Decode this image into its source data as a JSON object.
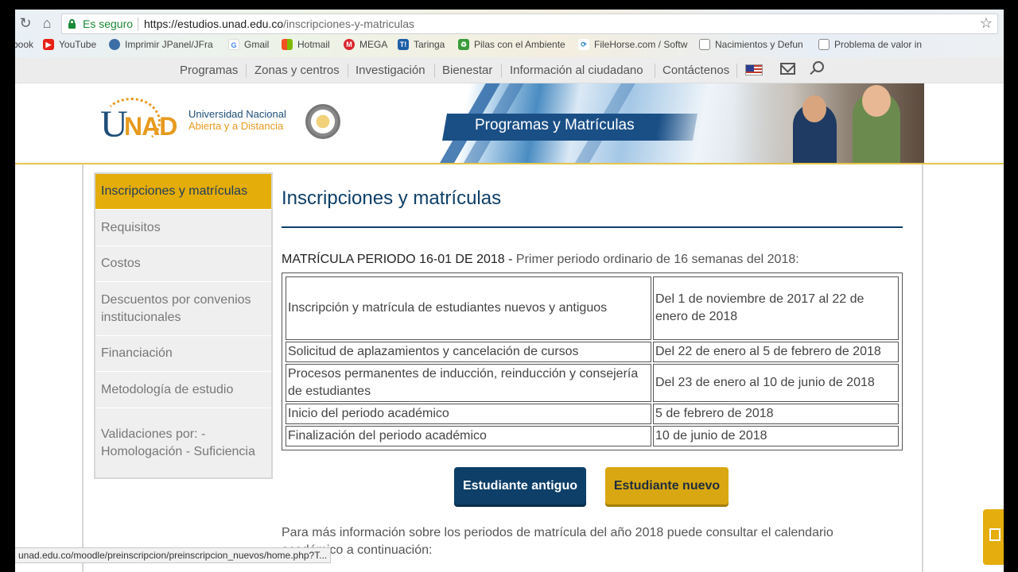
{
  "browser": {
    "secure_label": "Es seguro",
    "url_host": "https://estudios.unad.edu.co",
    "url_path": "/inscripciones-y-matriculas",
    "bookmarks": [
      {
        "label": "book"
      },
      {
        "label": "YouTube"
      },
      {
        "label": "Imprimir JPanel/JFra"
      },
      {
        "label": "Gmail"
      },
      {
        "label": "Hotmail"
      },
      {
        "label": "MEGA"
      },
      {
        "label": "Taringa"
      },
      {
        "label": "Pilas con el Ambiente"
      },
      {
        "label": "FileHorse.com / Softw"
      },
      {
        "label": "Nacimientos y Defun"
      },
      {
        "label": "Problema de valor in"
      }
    ]
  },
  "sitenav": {
    "items": [
      "Programas",
      "Zonas y centros",
      "Investigación",
      "Bienestar",
      "Información al ciudadano",
      "Contáctenos"
    ]
  },
  "header": {
    "logo_u": "U",
    "logo_nad": "NAD",
    "uni_line1": "Universidad Nacional",
    "uni_line2": "Abierta y a Distancia",
    "banner_title": "Programas y Matrículas"
  },
  "sidebar": {
    "items": [
      "Inscripciones y matrículas",
      "Requisitos",
      "Costos",
      "Descuentos por convenios institucionales",
      "Financiación",
      "Metodología de estudio",
      "Validaciones por: - Homologación - Suficiencia"
    ]
  },
  "main": {
    "title": "Inscripciones y matrículas",
    "period_bold": "MATRÍCULA PERIODO 16-01 DE 2018 -",
    "period_rest": " Primer periodo ordinario de 16 semanas del 2018:",
    "schedule": [
      {
        "activity": "Inscripción y matrícula de estudiantes nuevos y antiguos",
        "dates": "Del 1 de noviembre de 2017 al 22 de enero de 2018"
      },
      {
        "activity": "Solicitud de aplazamientos y cancelación de cursos",
        "dates": "Del 22 de enero al 5 de febrero de 2018"
      },
      {
        "activity": "Procesos permanentes de inducción, reinducción y consejería de estudiantes",
        "dates": "Del 23 de enero al 10 de junio de 2018"
      },
      {
        "activity": "Inicio del periodo académico",
        "dates": "5 de febrero de 2018"
      },
      {
        "activity": "Finalización del periodo académico",
        "dates": "10 de junio de 2018"
      }
    ],
    "btn_old": "Estudiante antiguo",
    "btn_new": "Estudiante nuevo",
    "more_info": "Para más información sobre los periodos de matrícula del año 2018 puede consultar el calendario académico a continuación:"
  },
  "status_url": "unad.edu.co/moodle/preinscripcion/preinscripcion_nuevos/home.php?T..."
}
